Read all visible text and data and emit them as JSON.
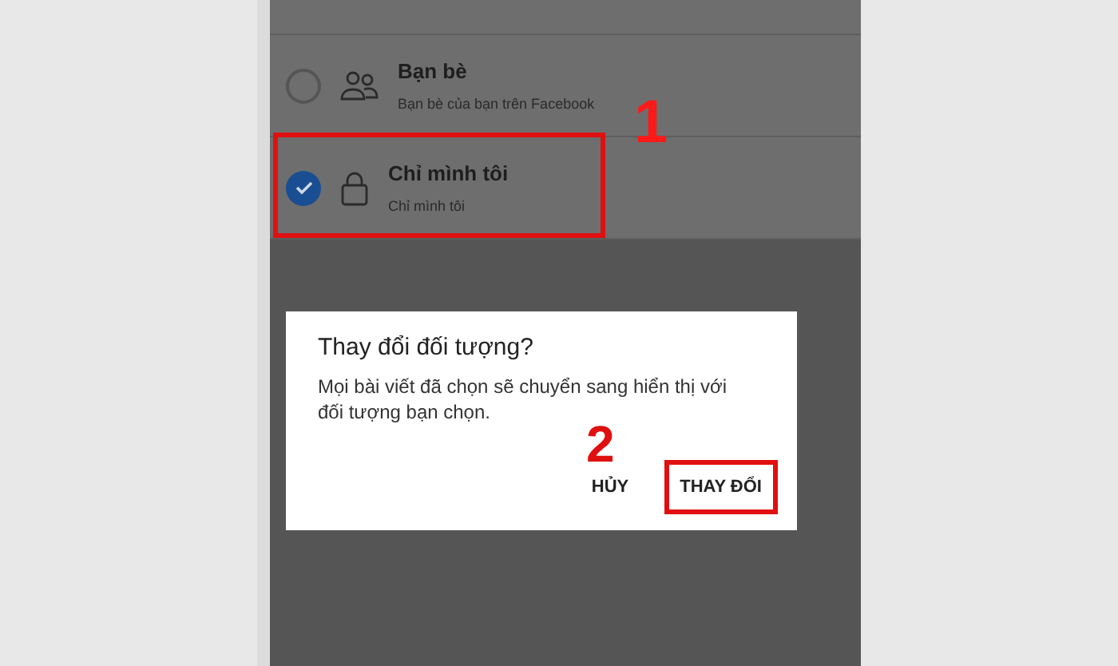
{
  "audience_options": [
    {
      "kind": "friends",
      "title": "Bạn bè",
      "subtitle": "Bạn bè của bạn trên Facebook",
      "selected": false,
      "highlighted": false
    },
    {
      "kind": "lock",
      "title": "Chỉ mình tôi",
      "subtitle": "Chỉ mình tôi",
      "selected": true,
      "highlighted": true
    }
  ],
  "step_labels": [
    "1",
    "2"
  ],
  "dialog": {
    "title": "Thay đổi đối tượng?",
    "message": "Mọi bài viết đã chọn sẽ chuyển sang hiển thị với đối tượng bạn chọn.",
    "buttons": [
      {
        "label": "HỦY",
        "highlighted": false
      },
      {
        "label": "THAY ĐỔI",
        "highlighted": true
      }
    ]
  }
}
